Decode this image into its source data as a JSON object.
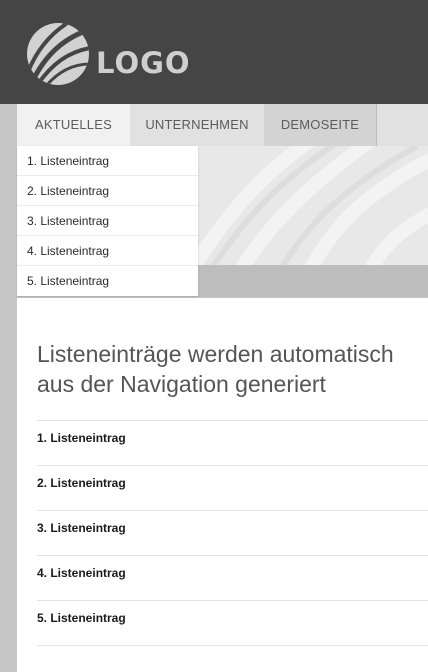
{
  "header": {
    "logo_text": "LOGO"
  },
  "nav": {
    "items": [
      {
        "label": "AKTUELLES"
      },
      {
        "label": "UNTERNEHMEN"
      },
      {
        "label": "DEMOSEITE"
      }
    ]
  },
  "dropdown": {
    "items": [
      {
        "label": "1. Listeneintrag"
      },
      {
        "label": "2. Listeneintrag"
      },
      {
        "label": "3. Listeneintrag"
      },
      {
        "label": "4. Listeneintrag"
      },
      {
        "label": "5. Listeneintrag"
      }
    ]
  },
  "main": {
    "headline": "Listeneinträge werden automatisch aus der Navigation generiert",
    "items": [
      {
        "label": "1. Listeneintrag"
      },
      {
        "label": "2. Listeneintrag"
      },
      {
        "label": "3. Listeneintrag"
      },
      {
        "label": "4. Listeneintrag"
      },
      {
        "label": "5. Listeneintrag"
      }
    ]
  },
  "colors": {
    "header_bg": "#454545",
    "nav_bg": "#e1e1e1",
    "page_bg": "#c6c6c6",
    "content_bg": "#ffffff"
  }
}
